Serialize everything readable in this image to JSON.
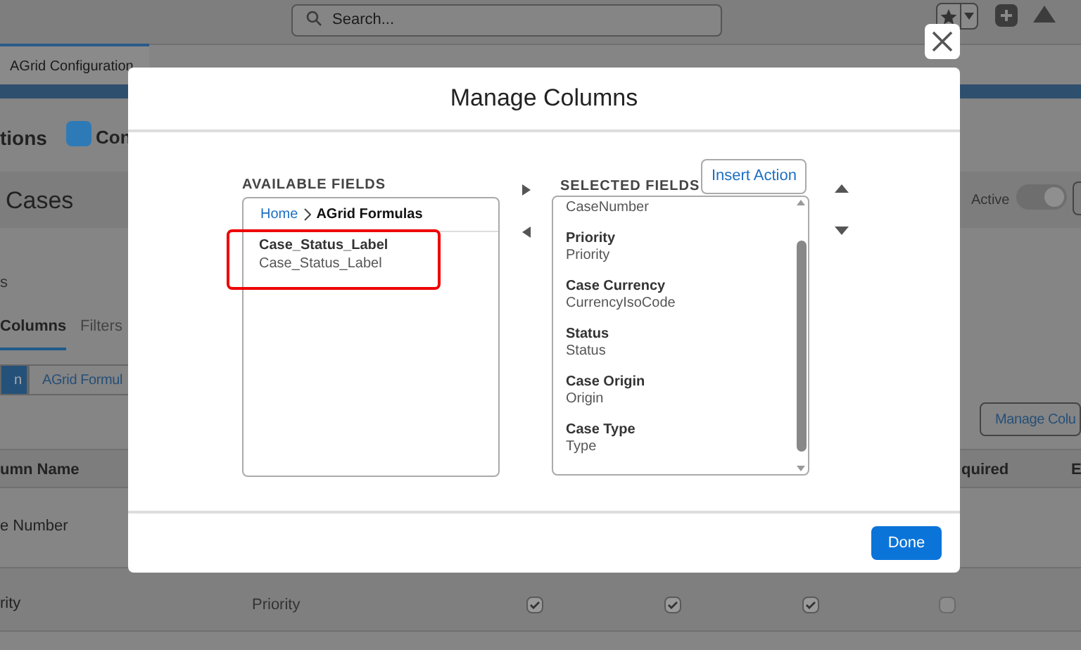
{
  "background": {
    "search": {
      "placeholder": "Search..."
    },
    "app_tab": "AGrid Configuration",
    "nav": [
      "tions",
      "Con"
    ],
    "title": "Cases",
    "active": {
      "label": "Active",
      "on": true
    },
    "fragment": "s",
    "tabs": [
      {
        "label": "Columns",
        "selected": true
      },
      {
        "label": "Filters",
        "selected": false
      }
    ],
    "subtabs": [
      {
        "label": "n",
        "selected": true
      },
      {
        "label": "AGrid Formul",
        "selected": false
      }
    ],
    "manage_button": "Manage Colu",
    "columns": [
      "umn Name",
      "quired",
      "E"
    ],
    "rows": [
      {
        "name": "e Number",
        "checks": []
      },
      {
        "name": "rity",
        "field": "Priority",
        "checks": [
          true,
          true,
          true,
          false
        ]
      }
    ]
  },
  "modal": {
    "title": "Manage Columns",
    "available": {
      "heading": "AVAILABLE FIELDS",
      "breadcrumb": [
        "Home",
        "AGrid Formulas"
      ],
      "items": [
        {
          "label": "Case_Status_Label",
          "api": "Case_Status_Label",
          "highlighted": true
        }
      ]
    },
    "selected": {
      "heading": "SELECTED FIELDS",
      "insert_button": "Insert Action",
      "items": [
        {
          "api": "CaseNumber"
        },
        {
          "label": "Priority",
          "api": "Priority"
        },
        {
          "label": "Case Currency",
          "api": "CurrencyIsoCode"
        },
        {
          "label": "Status",
          "api": "Status"
        },
        {
          "label": "Case Origin",
          "api": "Origin"
        },
        {
          "label": "Case Type",
          "api": "Type"
        }
      ]
    },
    "done_button": "Done"
  }
}
